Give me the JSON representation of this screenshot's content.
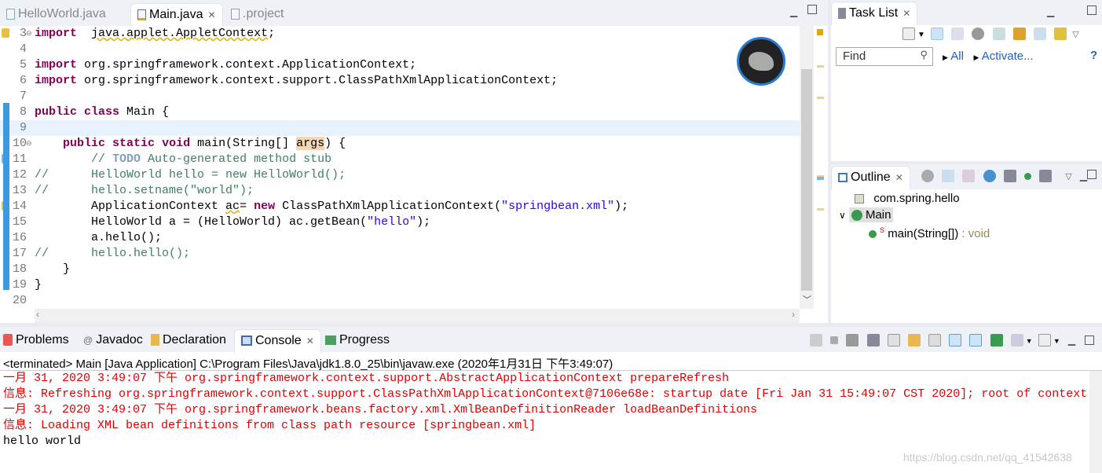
{
  "editor": {
    "tabs": [
      {
        "label": "HelloWorld.java",
        "icon": "java-file-icon"
      },
      {
        "label": "Main.java",
        "icon": "java-file-warning-icon",
        "active": true
      },
      {
        "label": ".project",
        "icon": "xml-file-icon"
      }
    ],
    "close_glyph": "✕",
    "current_line": 9,
    "lines": [
      {
        "n": "3",
        "fold": true,
        "warn": true,
        "s": [
          [
            "kw",
            "import"
          ],
          [
            "",
            "  "
          ],
          [
            "warnu",
            "java.applet.AppletContext"
          ],
          [
            "",
            ";"
          ]
        ]
      },
      {
        "n": "4",
        "s": []
      },
      {
        "n": "5",
        "s": [
          [
            "kw",
            "import"
          ],
          [
            "",
            " org.springframework.context.ApplicationContext;"
          ]
        ]
      },
      {
        "n": "6",
        "s": [
          [
            "kw",
            "import"
          ],
          [
            "",
            " org.springframework.context.support.ClassPathXmlApplicationContext;"
          ]
        ]
      },
      {
        "n": "7",
        "s": []
      },
      {
        "n": "8",
        "s": [
          [
            "kw",
            "public"
          ],
          [
            "",
            " "
          ],
          [
            "kw",
            "class"
          ],
          [
            "",
            " Main {"
          ]
        ]
      },
      {
        "n": "9",
        "s": []
      },
      {
        "n": "10",
        "fold": true,
        "s": [
          [
            "",
            "    "
          ],
          [
            "kw",
            "public"
          ],
          [
            "",
            " "
          ],
          [
            "kw",
            "static"
          ],
          [
            "",
            " "
          ],
          [
            "kw",
            "void"
          ],
          [
            "",
            " main(String[] "
          ],
          [
            "hl",
            "args"
          ],
          [
            "",
            ") {"
          ]
        ]
      },
      {
        "n": "11",
        "task": true,
        "s": [
          [
            "",
            "        "
          ],
          [
            "cm",
            "// "
          ],
          [
            "todo",
            "TODO"
          ],
          [
            "cm",
            " Auto-generated method stub"
          ]
        ]
      },
      {
        "n": "12",
        "s": [
          [
            "cm",
            "//      HelloWorld hello = new HelloWorld();"
          ]
        ]
      },
      {
        "n": "13",
        "s": [
          [
            "cm",
            "//      hello.setname(\"world\");"
          ]
        ]
      },
      {
        "n": "14",
        "warn": true,
        "s": [
          [
            "",
            "        ApplicationContext "
          ],
          [
            "warnu",
            "ac"
          ],
          [
            "",
            "= "
          ],
          [
            "kw",
            "new"
          ],
          [
            "",
            " ClassPathXmlApplicationContext("
          ],
          [
            "str",
            "\"springbean.xml\""
          ],
          [
            "",
            ");"
          ]
        ]
      },
      {
        "n": "15",
        "s": [
          [
            "",
            "        HelloWorld a = (HelloWorld) ac.getBean("
          ],
          [
            "str",
            "\"hello\""
          ],
          [
            "",
            ");"
          ]
        ]
      },
      {
        "n": "16",
        "s": [
          [
            "",
            "        a.hello();"
          ]
        ]
      },
      {
        "n": "17",
        "s": [
          [
            "cm",
            "//      hello.hello();"
          ]
        ]
      },
      {
        "n": "18",
        "s": [
          [
            "",
            "    }"
          ]
        ]
      },
      {
        "n": "19",
        "s": [
          [
            "",
            "}"
          ]
        ]
      },
      {
        "n": "20",
        "s": []
      }
    ]
  },
  "tasklist": {
    "title": "Task List",
    "find_placeholder": "Find",
    "all": "All",
    "activate": "Activate...",
    "help": "?"
  },
  "outline": {
    "title": "Outline",
    "package": "com.spring.hello",
    "class": "Main",
    "method": "main(String[])",
    "method_type": " : void",
    "static_marker": "S"
  },
  "bottom": {
    "tabs": [
      {
        "label": "Problems"
      },
      {
        "label": "Javadoc"
      },
      {
        "label": "Declaration"
      },
      {
        "label": "Console",
        "active": true
      },
      {
        "label": "Progress"
      }
    ],
    "status": "<terminated> Main [Java Application] C:\\Program Files\\Java\\jdk1.8.0_25\\bin\\javaw.exe (2020年1月31日 下午3:49:07)",
    "console": [
      {
        "t": "一月 31, 2020 3:49:07 下午 org.springframework.context.support.AbstractApplicationContext prepareRefresh",
        "err": true
      },
      {
        "t": "信息: Refreshing org.springframework.context.support.ClassPathXmlApplicationContext@7106e68e: startup date [Fri Jan 31 15:49:07 CST 2020]; root of context",
        "err": true
      },
      {
        "t": "一月 31, 2020 3:49:07 下午 org.springframework.beans.factory.xml.XmlBeanDefinitionReader loadBeanDefinitions",
        "err": true
      },
      {
        "t": "信息: Loading XML bean definitions from class path resource [springbean.xml]",
        "err": true
      },
      {
        "t": "hello world",
        "err": false
      }
    ],
    "watermark": "https://blog.csdn.net/qq_41542638"
  }
}
